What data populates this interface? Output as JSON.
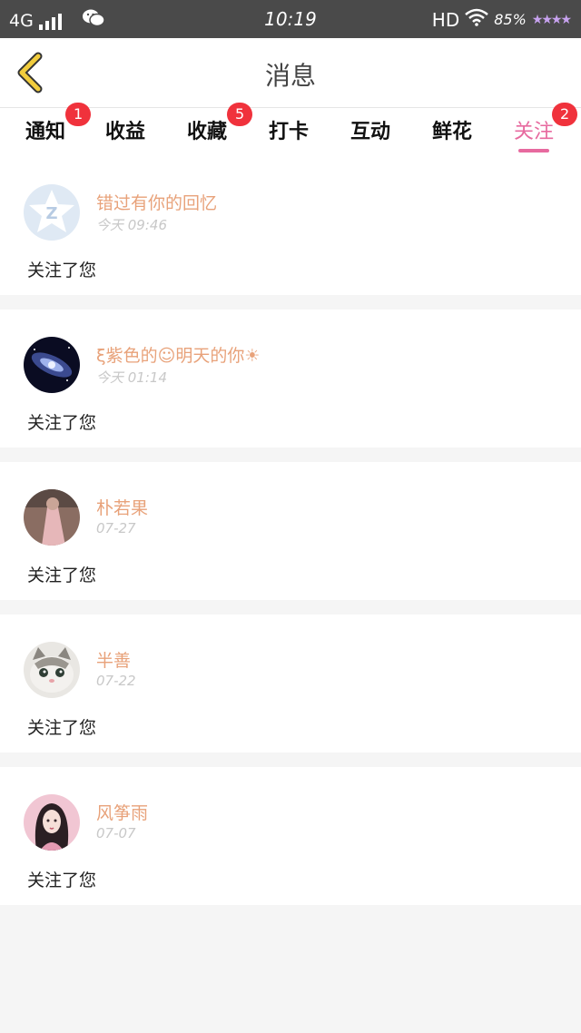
{
  "status_bar": {
    "network": "4G",
    "time": "10:19",
    "hd": "HD",
    "battery": "85%"
  },
  "header": {
    "title": "消息"
  },
  "tabs": [
    {
      "label": "通知",
      "badge": "1"
    },
    {
      "label": "收益",
      "badge": ""
    },
    {
      "label": "收藏",
      "badge": "5"
    },
    {
      "label": "打卡",
      "badge": ""
    },
    {
      "label": "互动",
      "badge": ""
    },
    {
      "label": "鲜花",
      "badge": ""
    },
    {
      "label": "关注",
      "badge": "2",
      "active": true
    }
  ],
  "messages": [
    {
      "name": "错过有你的回忆",
      "time": "今天 09:46",
      "text": "关注了您",
      "avatar": "default-qq-avatar"
    },
    {
      "name": "ξ紫色的☺明天的你☀",
      "time": "今天 01:14",
      "text": "关注了您",
      "avatar": "galaxy-avatar"
    },
    {
      "name": "朴若果",
      "time": "07-27",
      "text": "关注了您",
      "avatar": "pink-dress-avatar"
    },
    {
      "name": "半善",
      "time": "07-22",
      "text": "关注了您",
      "avatar": "cat-avatar"
    },
    {
      "name": "风筝雨",
      "time": "07-07",
      "text": "关注了您",
      "avatar": "doll-avatar"
    }
  ],
  "colors": {
    "accent": "#e76a9f",
    "badge": "#f0323c",
    "name": "#e8a27a",
    "back_arrow": "#f2cd3d"
  }
}
